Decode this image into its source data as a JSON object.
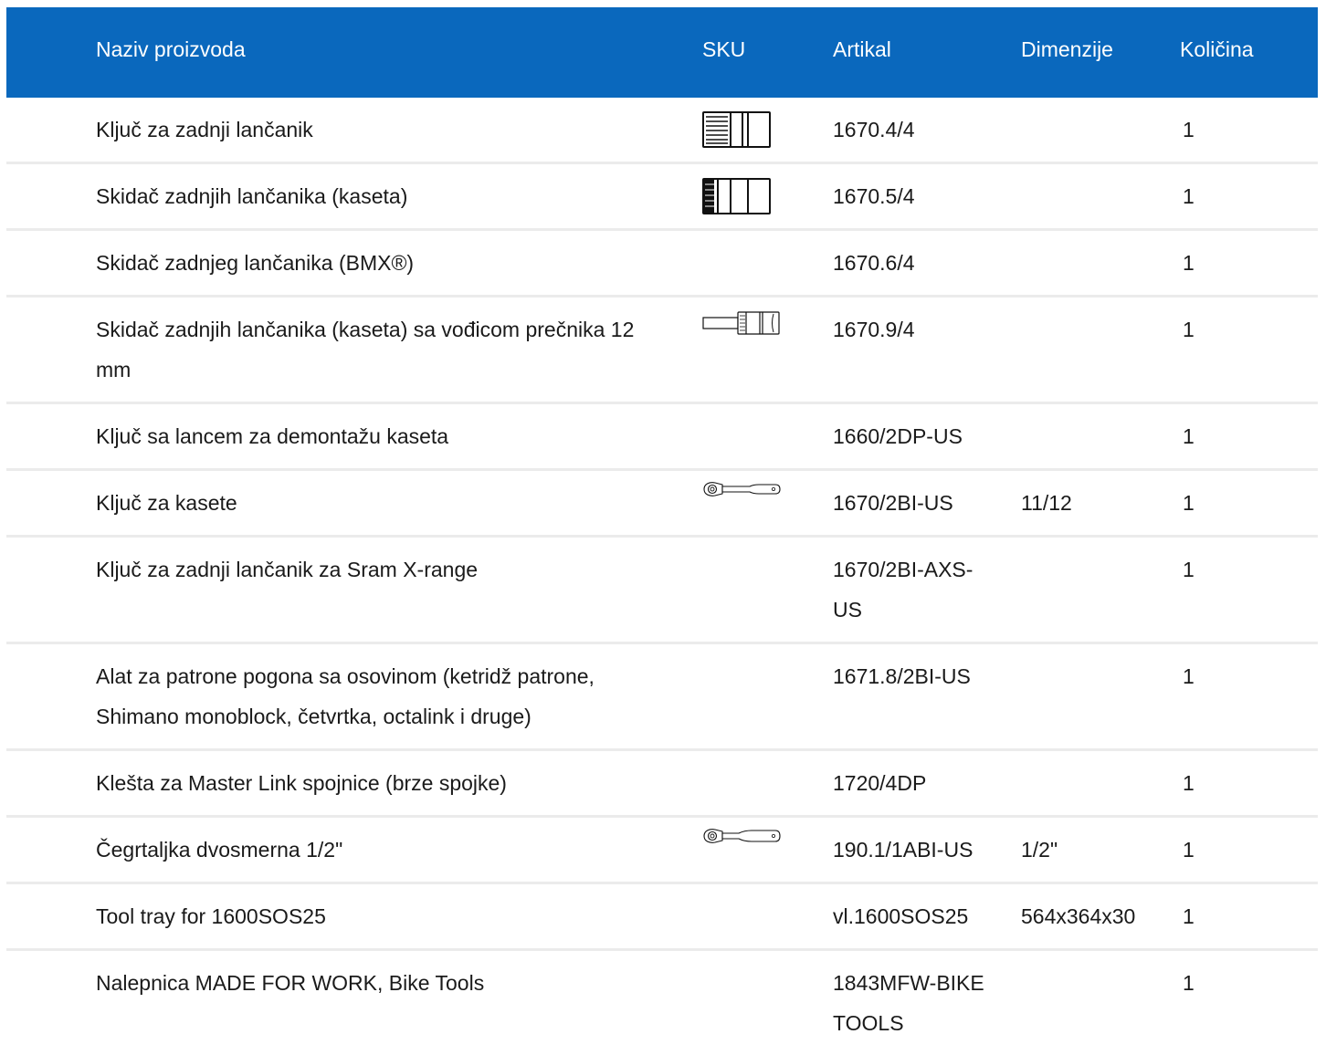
{
  "columns": {
    "name": "Naziv proizvoda",
    "sku": "SKU",
    "article": "Artikal",
    "dimensions": "Dimenzije",
    "quantity": "Količina"
  },
  "rows": [
    {
      "name": "Ključ za zadnji lančanik",
      "sku_icon": "cassette-socket-icon",
      "article": "1670.4/4",
      "dimensions": "",
      "quantity": "1"
    },
    {
      "name": "Skidač zadnjih lančanika (kaseta)",
      "sku_icon": "cassette-socket-icon",
      "article": "1670.5/4",
      "dimensions": "",
      "quantity": "1"
    },
    {
      "name": "Skidač zadnjeg lančanika (BMX®)",
      "sku_icon": "",
      "article": "1670.6/4",
      "dimensions": "",
      "quantity": "1"
    },
    {
      "name": "Skidač zadnjih lančanika (kaseta) sa vođicom prečnika 12 mm",
      "sku_icon": "guided-socket-icon",
      "article": "1670.9/4",
      "dimensions": "",
      "quantity": "1"
    },
    {
      "name": "Ključ sa lancem za demontažu kaseta",
      "sku_icon": "",
      "article": "1660/2DP-US",
      "dimensions": "",
      "quantity": "1"
    },
    {
      "name": "Ključ za kasete",
      "sku_icon": "ratchet-icon",
      "article": "1670/2BI-US",
      "dimensions": "11/12",
      "quantity": "1"
    },
    {
      "name": "Ključ za zadnji lančanik za Sram X-range",
      "sku_icon": "",
      "article": "1670/2BI-AXS-US",
      "dimensions": "",
      "quantity": "1"
    },
    {
      "name": "Alat za patrone pogona sa osovinom (ketridž patrone, Shimano monoblock, četvrtka, octalink i druge)",
      "sku_icon": "",
      "article": "1671.8/2BI-US",
      "dimensions": "",
      "quantity": "1"
    },
    {
      "name": "Klešta za Master Link spojnice (brze spojke)",
      "sku_icon": "",
      "article": "1720/4DP",
      "dimensions": "",
      "quantity": "1"
    },
    {
      "name": "Čegrtaljka dvosmerna 1/2\"",
      "sku_icon": "ratchet-icon",
      "article": "190.1/1ABI-US",
      "dimensions": "1/2\"",
      "quantity": "1"
    },
    {
      "name": "Tool tray for 1600SOS25",
      "sku_icon": "",
      "article": "vl.1600SOS25",
      "dimensions": "564x364x30",
      "quantity": "1"
    },
    {
      "name": "Nalepnica MADE FOR WORK, Bike Tools",
      "sku_icon": "",
      "article": "1843MFW-BIKE TOOLS",
      "dimensions": "",
      "quantity": "1"
    }
  ],
  "colors": {
    "header_bg": "#0a68bd",
    "header_text": "#ffffff",
    "row_divider": "#ebebeb"
  }
}
